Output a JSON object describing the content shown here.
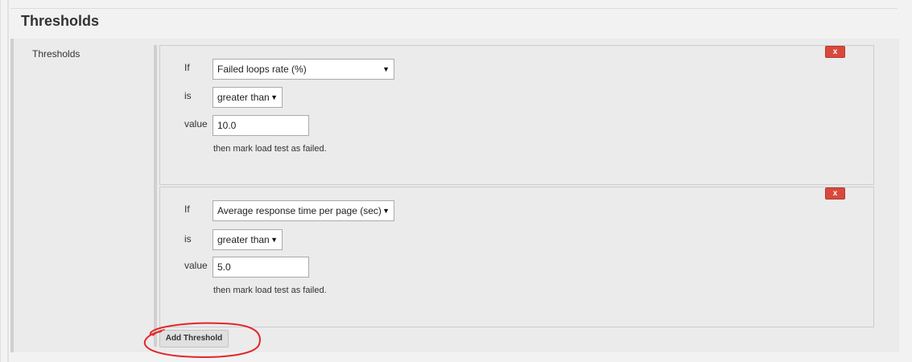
{
  "section": {
    "title": "Thresholds"
  },
  "panel": {
    "label": "Thresholds"
  },
  "thresholds": [
    {
      "if_label": "If",
      "metric": "Failed loops rate (%)",
      "is_label": "is",
      "operator": "greater than",
      "value_label": "value",
      "value": "10.0",
      "note": "then mark load test as failed.",
      "close_label": "x"
    },
    {
      "if_label": "If",
      "metric": "Average response time per page (sec)",
      "is_label": "is",
      "operator": "greater than",
      "value_label": "value",
      "value": "5.0",
      "note": "then mark load test as failed.",
      "close_label": "x"
    }
  ],
  "add_button": {
    "label": "Add Threshold"
  },
  "icons": {
    "dropdown": "triangle-down-icon",
    "close": "close-icon"
  },
  "colors": {
    "close_button": "#d9493b",
    "annotation": "#e3262a"
  }
}
